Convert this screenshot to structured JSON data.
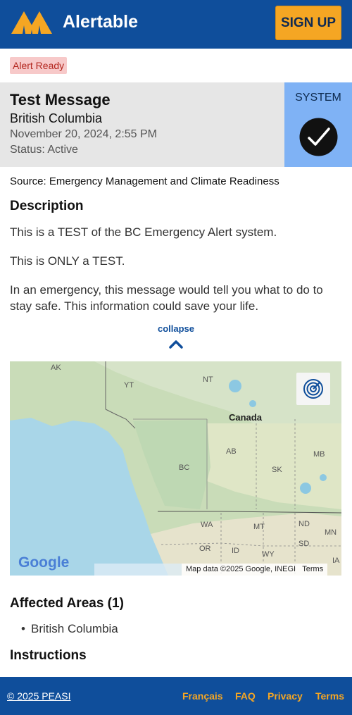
{
  "header": {
    "brand": "Alertable",
    "signup_label": "SIGN UP",
    "colors": {
      "bar": "#0f4e9b",
      "accent": "#f5a623"
    }
  },
  "badge": {
    "label": "Alert Ready"
  },
  "alert": {
    "title": "Test Message",
    "region": "British Columbia",
    "date": "November 20, 2024, 2:55 PM",
    "status": "Status: Active",
    "category": "SYSTEM",
    "category_icon": "check-circle-icon"
  },
  "source": "Source: Emergency Management and Climate Readiness",
  "description": {
    "heading": "Description",
    "paragraphs": [
      "This is a TEST of the BC Emergency Alert system.",
      "This is ONLY a TEST.",
      "In an emergency, this message would tell you what to do to stay safe. This information could save your life."
    ]
  },
  "collapse_label": "collapse",
  "map": {
    "labels": [
      "AK",
      "YT",
      "NT",
      "Canada",
      "AB",
      "MB",
      "BC",
      "SK",
      "WA",
      "MT",
      "ND",
      "MN",
      "SD",
      "OR",
      "ID",
      "WY",
      "IA"
    ],
    "attribution": "Map data ©2025 Google, INEGI",
    "terms": "Terms",
    "logo": "Google"
  },
  "affected": {
    "heading": "Affected Areas (1)",
    "items": [
      "British Columbia"
    ]
  },
  "instructions": {
    "heading": "Instructions"
  },
  "footer": {
    "copyright": "© 2025 PEASI",
    "links": [
      "Français",
      "FAQ",
      "Privacy",
      "Terms"
    ]
  }
}
